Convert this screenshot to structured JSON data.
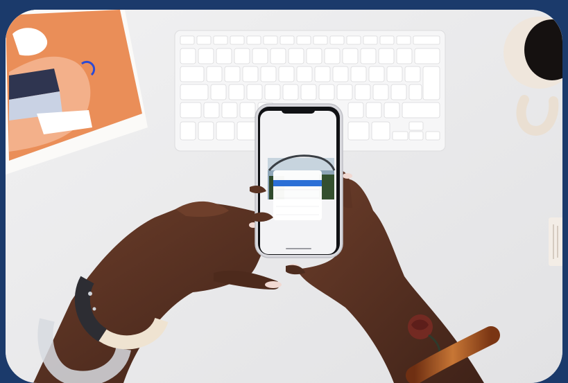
{
  "colors": {
    "page_background": "#1b3a6b",
    "desk": "#ededee",
    "print_orange": "#e98a55",
    "keyboard": "#f4f4f5",
    "phone_frame": "#d9d9de",
    "phone_accent": "#2b6fd6",
    "skin": "#5a3323",
    "nails": "#f0d6cf",
    "mug": "#f3ece4",
    "bangle_amber": "#b4612b"
  },
  "icons": [
    "keyboard",
    "smartphone",
    "mug",
    "bracelet",
    "art-print"
  ],
  "phone": {
    "header_text": "",
    "menu_items": [
      "",
      "",
      "",
      "",
      ""
    ]
  }
}
